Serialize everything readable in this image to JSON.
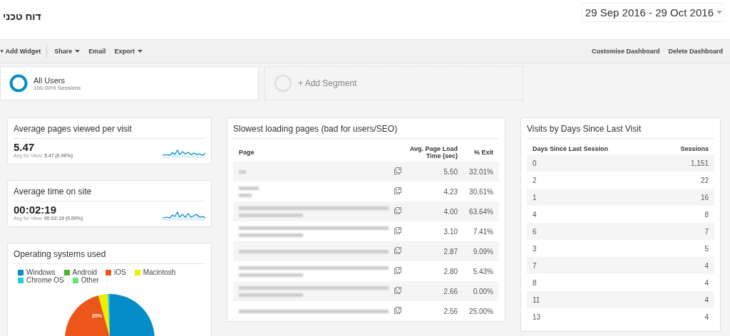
{
  "header": {
    "title": "דוח טכני",
    "date_range": "29 Sep 2016 - 29 Oct 2016"
  },
  "toolbar": {
    "left": [
      {
        "label": "+ Add Widget",
        "dropdown": false
      },
      {
        "label": "Share",
        "dropdown": true
      },
      {
        "label": "Email",
        "dropdown": false
      },
      {
        "label": "Export",
        "dropdown": true
      }
    ],
    "right": [
      "Customise Dashboard",
      "Delete Dashboard"
    ]
  },
  "segments": [
    {
      "kind": "active",
      "name": "All Users",
      "detail": "100.00% Sessions"
    },
    {
      "kind": "add",
      "name": "+ Add Segment"
    }
  ],
  "metrics": [
    {
      "title": "Average pages viewed per visit",
      "value": "5.47",
      "note": "Avg for View: ",
      "note_value": "5.47 (0.00%)"
    },
    {
      "title": "Average time on site",
      "value": "00:02:19",
      "note": "Avg for View: ",
      "note_value": "00:02:19 (0.00%)"
    }
  ],
  "os_widget": {
    "title": "Operating systems used",
    "legend": [
      {
        "label": "Windows",
        "color": "#058dc7"
      },
      {
        "label": "Android",
        "color": "#50b432"
      },
      {
        "label": "iOS",
        "color": "#ed561b"
      },
      {
        "label": "Macintosh",
        "color": "#edef00"
      },
      {
        "label": "Chrome OS",
        "color": "#24cbe5"
      },
      {
        "label": "Other",
        "color": "#64e572"
      }
    ],
    "slice_label": "20%"
  },
  "slow_pages": {
    "title": "Slowest loading pages (bad for users/SEO)",
    "columns": [
      "Page",
      "Avg. Page Load Time (sec)",
      "% Exit"
    ],
    "rows": [
      {
        "kind": "tiny",
        "load_time": "5.50",
        "exit": "32.01%"
      },
      {
        "kind": "short",
        "load_time": "4.23",
        "exit": "30.61%"
      },
      {
        "kind": "wrapped",
        "load_time": "4.00",
        "exit": "63.64%"
      },
      {
        "kind": "wrapped",
        "load_time": "3.10",
        "exit": "7.41%"
      },
      {
        "kind": "long",
        "load_time": "2.87",
        "exit": "9.09%"
      },
      {
        "kind": "wrapped",
        "load_time": "2.80",
        "exit": "5.43%"
      },
      {
        "kind": "wrapped",
        "load_time": "2.66",
        "exit": "0.00%"
      },
      {
        "kind": "long",
        "load_time": "2.56",
        "exit": "25.00%"
      }
    ]
  },
  "days_widget": {
    "title": "Visits by Days Since Last Visit",
    "columns": [
      "Days Since Last Session",
      "Sessions"
    ],
    "rows": [
      [
        "0",
        "1,151"
      ],
      [
        "2",
        "22"
      ],
      [
        "1",
        "16"
      ],
      [
        "4",
        "8"
      ],
      [
        "6",
        "7"
      ],
      [
        "3",
        "5"
      ],
      [
        "7",
        "4"
      ],
      [
        "8",
        "4"
      ],
      [
        "11",
        "4"
      ],
      [
        "13",
        "4"
      ]
    ]
  }
}
